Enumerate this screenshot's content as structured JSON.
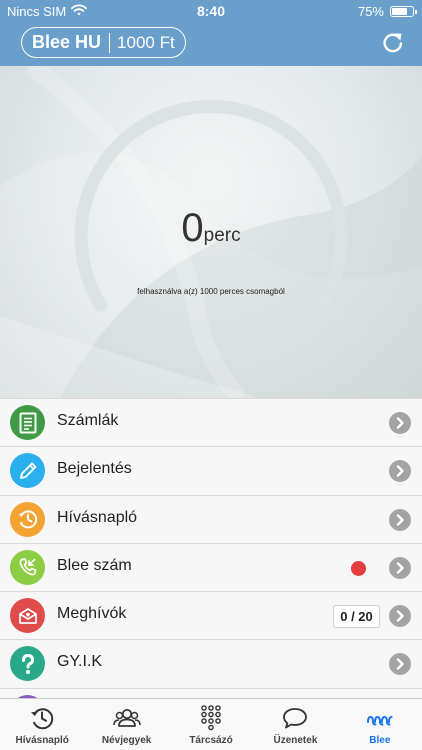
{
  "status_bar": {
    "carrier": "Nincs SIM",
    "time": "8:40",
    "battery_percent": "75%",
    "battery_level": 0.75
  },
  "header": {
    "plan_name": "Blee HU",
    "plan_price": "1000 Ft",
    "refresh_icon": "refresh-icon"
  },
  "gauge": {
    "value": "0",
    "unit": "perc",
    "caption": "felhasználva a(z) 1000 perces csomagból",
    "used_fraction": 0
  },
  "menu": {
    "items": [
      {
        "label": "Számlák",
        "icon": "invoice-icon",
        "color": "#3e9a44"
      },
      {
        "label": "Bejelentés",
        "icon": "pencil-icon",
        "color": "#2ab0ee"
      },
      {
        "label": "Hívásnapló",
        "icon": "history-icon",
        "color": "#f4a232"
      },
      {
        "label": "Blee szám",
        "icon": "incoming-call-icon",
        "color": "#8ccd44",
        "has_notification": true
      },
      {
        "label": "Meghívók",
        "icon": "invite-envelope-icon",
        "color": "#e04b4b",
        "badge": "0 / 20"
      },
      {
        "label": "GY.I.K",
        "icon": "question-icon",
        "color": "#29a98a"
      }
    ],
    "colors": {
      "chevron": "#a3a3a3",
      "notification": "#e53d3d"
    }
  },
  "tabbar": {
    "tabs": [
      {
        "label": "Hívásnapló",
        "icon": "history-icon",
        "active": false
      },
      {
        "label": "Névjegyek",
        "icon": "contacts-icon",
        "active": false
      },
      {
        "label": "Tárcsázó",
        "icon": "dialpad-icon",
        "active": false
      },
      {
        "label": "Üzenetek",
        "icon": "chat-bubble-icon",
        "active": false
      },
      {
        "label": "Blee",
        "icon": "blee-logo-icon",
        "active": true
      }
    ],
    "active_color": "#1874e8"
  },
  "theme": {
    "header_bg": "#6a9fcc"
  }
}
